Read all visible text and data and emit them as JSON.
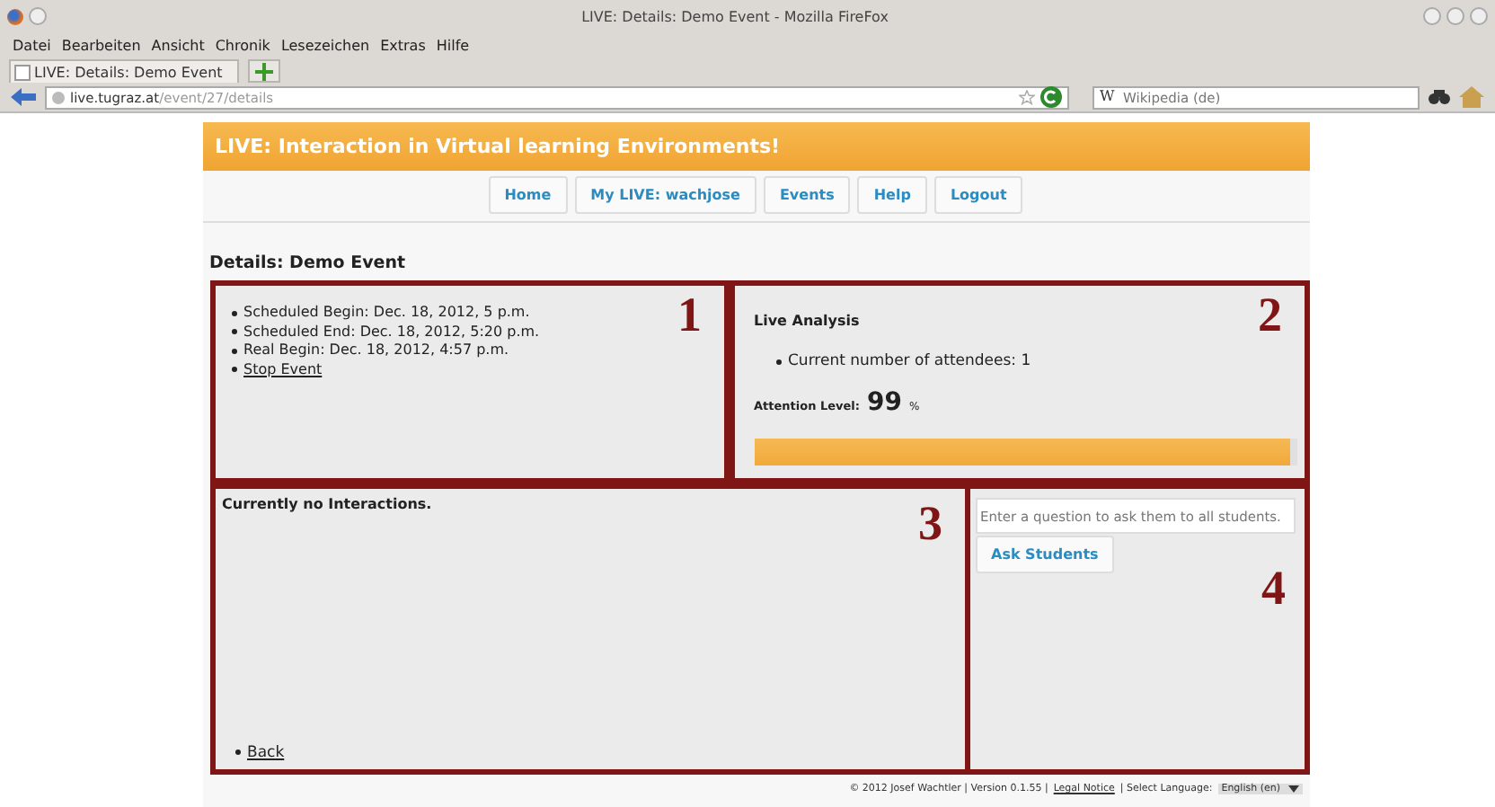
{
  "window": {
    "title": "LIVE: Details: Demo Event - Mozilla FireFox"
  },
  "menu": [
    "Datei",
    "Bearbeiten",
    "Ansicht",
    "Chronik",
    "Lesezeichen",
    "Extras",
    "Hilfe"
  ],
  "tabs": [
    {
      "label": "LIVE: Details: Demo Event",
      "selected": true
    }
  ],
  "address_bar": {
    "host": "live.tugraz.at",
    "path": "/event/27/details"
  },
  "search": {
    "engine_icon": "W",
    "placeholder": "Wikipedia (de)"
  },
  "site": {
    "banner": "LIVE: Interaction in Virtual learning Environments!",
    "nav": [
      "Home",
      "My LIVE: wachjose",
      "Events",
      "Help",
      "Logout"
    ],
    "heading": "Details: Demo Event"
  },
  "event_info": [
    {
      "kind": "text",
      "text": "Scheduled Begin: Dec. 18, 2012, 5 p.m."
    },
    {
      "kind": "text",
      "text": "Scheduled End: Dec. 18, 2012, 5:20 p.m."
    },
    {
      "kind": "text",
      "text": "Real Begin: Dec. 18, 2012, 4:57 p.m."
    },
    {
      "kind": "link",
      "text": "Stop Event"
    }
  ],
  "live_analysis": {
    "title": "Live Analysis",
    "items": [
      "Current number of attendees: 1"
    ],
    "attention_label": "Attention Level:",
    "attention_value": "99",
    "attention_unit": "%",
    "level": 0.99
  },
  "interactions": {
    "message": "Currently no Interactions.",
    "back_link": "Back"
  },
  "question": {
    "placeholder": "Enter a question to ask them to all students.",
    "button": "Ask Students"
  },
  "annotations": [
    "1",
    "2",
    "3",
    "4"
  ],
  "footer": {
    "copyright": "© 2012 Josef Wachtler | Version 0.1.55 |",
    "legal_link": "Legal Notice",
    "language_label": "| Select Language:",
    "language": "English (en)"
  }
}
